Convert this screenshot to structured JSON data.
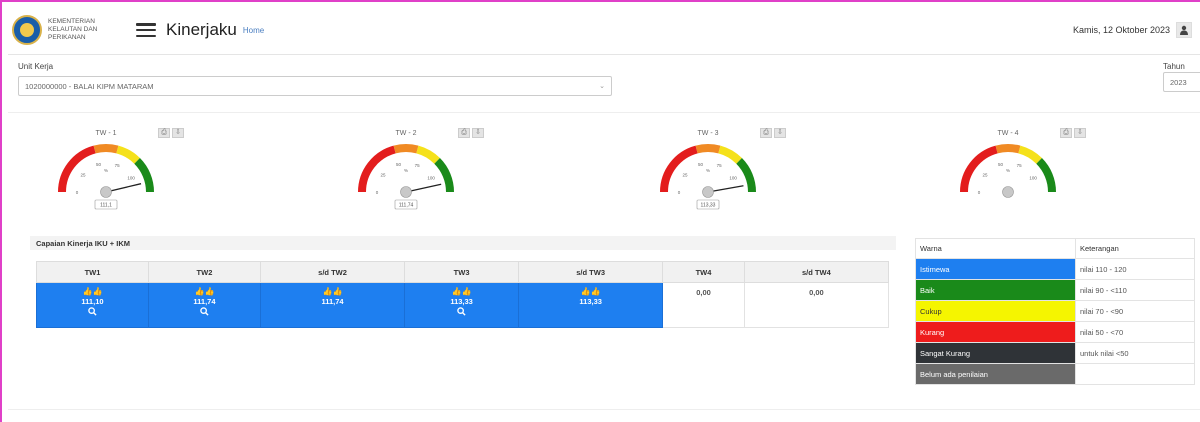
{
  "header": {
    "org_line1": "KEMENTERIAN",
    "org_line2": "KELAUTAN DAN",
    "org_line3": "PERIKANAN",
    "title": "Kinerjaku",
    "subtitle": "Home",
    "date": "Kamis, 12 Oktober 2023",
    "icons": {
      "menu": "hamburger-icon",
      "user": "user-icon",
      "logo": "kkp-logo"
    }
  },
  "filters": {
    "unit_label": "Unit Kerja",
    "unit_value": "1020000000 - BALAI KIPM MATARAM",
    "year_label": "Tahun",
    "year_value": "2023"
  },
  "gauges": [
    {
      "title": "TW - 1",
      "value": 111.1,
      "readout": "111,1"
    },
    {
      "title": "TW - 2",
      "value": 111.74,
      "readout": "111,74"
    },
    {
      "title": "TW - 3",
      "value": 113.33,
      "readout": "113,33"
    },
    {
      "title": "TW - 4",
      "value": null,
      "readout": ""
    }
  ],
  "gauge_scale": {
    "ticks": [
      "0",
      "25",
      "50",
      "75",
      "100"
    ],
    "unit": "%"
  },
  "performance": {
    "title": "Capaian Kinerja IKU + IKM",
    "headers": [
      "TW1",
      "TW2",
      "s/d TW2",
      "TW3",
      "s/d TW3",
      "TW4",
      "s/d TW4"
    ],
    "cells": [
      {
        "value": "111,10",
        "blue": true,
        "search": true
      },
      {
        "value": "111,74",
        "blue": true,
        "search": true
      },
      {
        "value": "111,74",
        "blue": true,
        "search": false
      },
      {
        "value": "113,33",
        "blue": true,
        "search": true
      },
      {
        "value": "113,33",
        "blue": true,
        "search": false
      },
      {
        "value": "0,00",
        "blue": false,
        "search": false
      },
      {
        "value": "0,00",
        "blue": false,
        "search": false
      }
    ]
  },
  "legend": {
    "col_warna": "Warna",
    "col_keterangan": "Keterangan",
    "rows": [
      {
        "label": "Istimewa",
        "desc": "nilai 110 - 120",
        "color": "#1e7ff0",
        "text_color": "#ffffff"
      },
      {
        "label": "Baik",
        "desc": "nilai 90 - <110",
        "color": "#1a8a1a",
        "text_color": "#ffffff"
      },
      {
        "label": "Cukup",
        "desc": "nilai 70 - <90",
        "color": "#f5f500",
        "text_color": "#333333"
      },
      {
        "label": "Kurang",
        "desc": "nilai 50 - <70",
        "color": "#ee1c1c",
        "text_color": "#ffffff"
      },
      {
        "label": "Sangat Kurang",
        "desc": "untuk nilai <50",
        "color": "#2f3337",
        "text_color": "#ffffff"
      },
      {
        "label": "Belum ada penilaian",
        "desc": "",
        "color": "#6a6a6a",
        "text_color": "#ffffff"
      }
    ]
  }
}
